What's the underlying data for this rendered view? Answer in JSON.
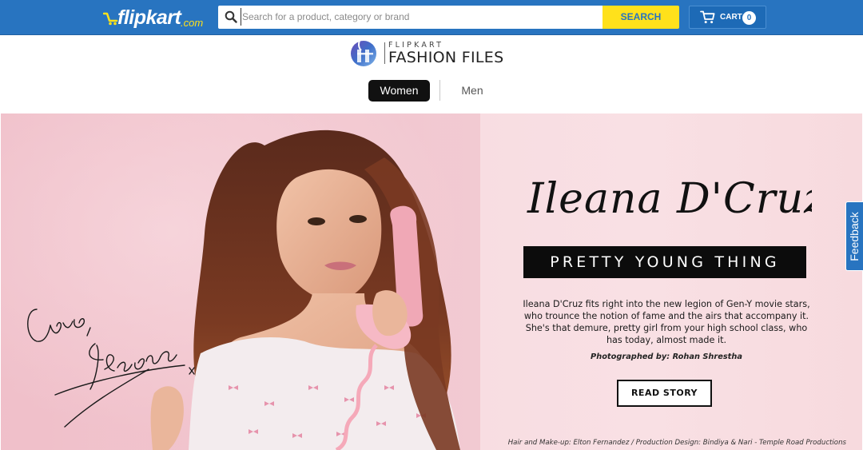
{
  "header": {
    "logo_text": "flipkart",
    "logo_suffix": ".com",
    "search": {
      "placeholder": "Search for a product, category or brand",
      "value": ""
    },
    "search_button_label": "SEARCH",
    "cart": {
      "label": "CART",
      "count": "0"
    },
    "colors": {
      "brand_blue": "#2874c0",
      "brand_yellow": "#ffe11b"
    }
  },
  "brand": {
    "line1": "FLIPKART",
    "line2": "FASHION FILES"
  },
  "tabs": [
    {
      "label": "Women",
      "active": true
    },
    {
      "label": "Men",
      "active": false
    }
  ],
  "hero": {
    "name": "Ileana D'Cruz",
    "tagline": "PRETTY YOUNG THING",
    "description": "Ileana D'Cruz fits right into the new legion of Gen-Y movie stars, who trounce the notion of fame and the airs that accompany it. She's that demure, pretty girl from your high school class, who has today, almost made it.",
    "photo_credit": "Photographed by: Rohan Shrestha",
    "cta_label": "READ STORY",
    "footer_credit": "Hair and Make-up: Elton Fernandez / Production Design: Bindiya & Nari - Temple Road Productions",
    "signature_line1": "Love,",
    "signature_line2": "Ileana"
  },
  "feedback": {
    "label": "Feedback"
  }
}
